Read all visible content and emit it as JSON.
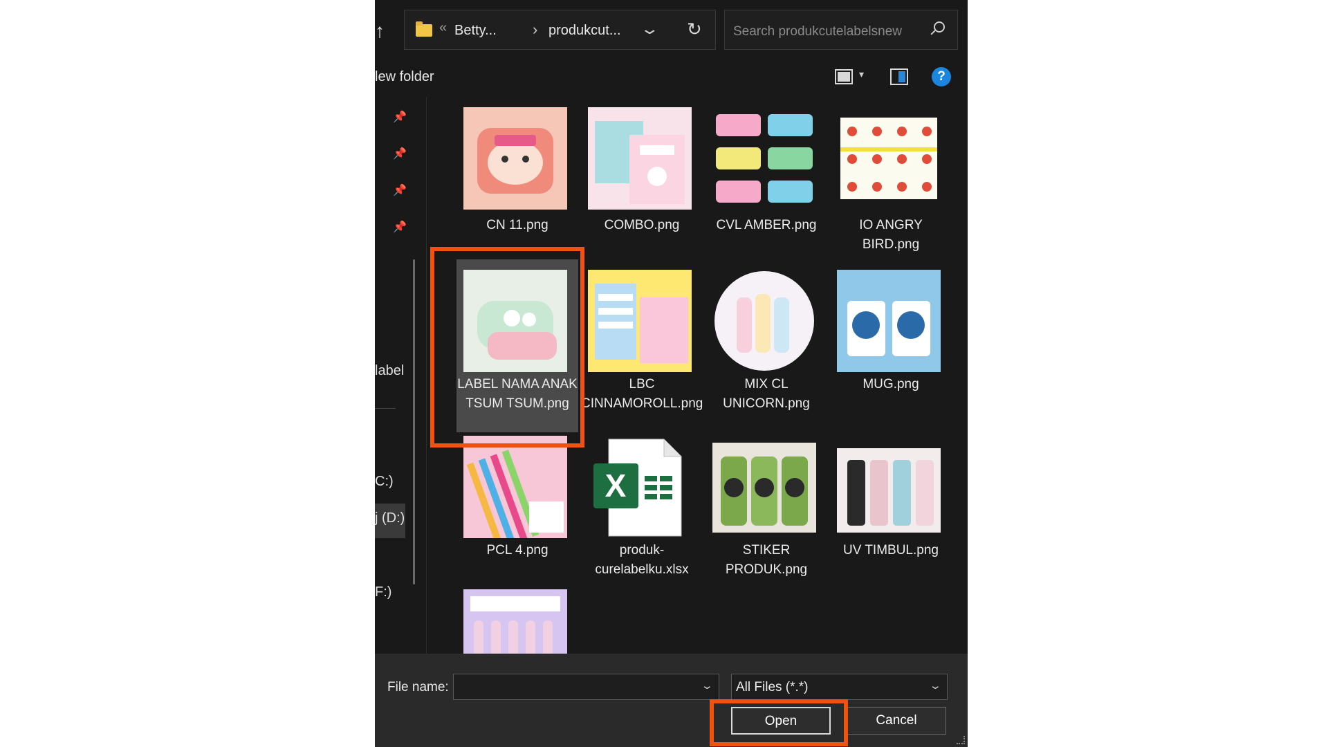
{
  "address": {
    "crumb_prefix": "«",
    "crumb_1": "Betty...",
    "crumb_sep": "›",
    "crumb_2": "produkcut...",
    "search_placeholder": "Search produkcutelabelsnew"
  },
  "toolbar": {
    "new_folder": "lew folder",
    "help": "?"
  },
  "nav": {
    "items": [
      {
        "text": "label"
      },
      {
        "text": "C:)"
      },
      {
        "text": "j (D:)"
      },
      {
        "text": "F:)"
      }
    ]
  },
  "files": [
    {
      "name": "CN 11.png",
      "colors": [
        "#f6b9a8",
        "#f08a7a"
      ]
    },
    {
      "name": "COMBO.png",
      "colors": [
        "#f8d7e3",
        "#9fd3d8"
      ]
    },
    {
      "name": "CVL AMBER.png",
      "colors": [
        "#f6a9c8",
        "#7fd0e8"
      ]
    },
    {
      "name": "IO ANGRY BIRD.png",
      "colors": [
        "#fbfbef",
        "#e14b3a"
      ]
    },
    {
      "name": "LABEL NAMA ANAK TSUM TSUM.png",
      "colors": [
        "#d7ecdc",
        "#f4b9c5"
      ]
    },
    {
      "name": "LBC CINNAMOROLL.png",
      "colors": [
        "#ffe872",
        "#9ed0f0"
      ]
    },
    {
      "name": "MIX CL UNICORN.png",
      "colors": [
        "#f6f1f7",
        "#f8d0dd"
      ]
    },
    {
      "name": "MUG.png",
      "colors": [
        "#8fc8e8",
        "#2b6aa8"
      ]
    },
    {
      "name": "PCL 4.png",
      "colors": [
        "#f7c7d8",
        "#f5b842"
      ]
    },
    {
      "name": "produk-curelabelku.xlsx",
      "colors": [
        "#1d6f42",
        "#ffffff"
      ]
    },
    {
      "name": "STIKER PRODUK.png",
      "colors": [
        "#7aa84a",
        "#2a2a2a"
      ]
    },
    {
      "name": "UV TIMBUL.png",
      "colors": [
        "#e9c4cc",
        "#9fd0dc"
      ]
    },
    {
      "name": "",
      "colors": [
        "#d6c5f0",
        "#f2d0e4"
      ]
    }
  ],
  "bottom": {
    "file_name_label": "File name:",
    "file_name_value": "",
    "file_type": "All Files (*.*)",
    "open": "Open",
    "cancel": "Cancel"
  },
  "highlight_color": "#f0520f"
}
